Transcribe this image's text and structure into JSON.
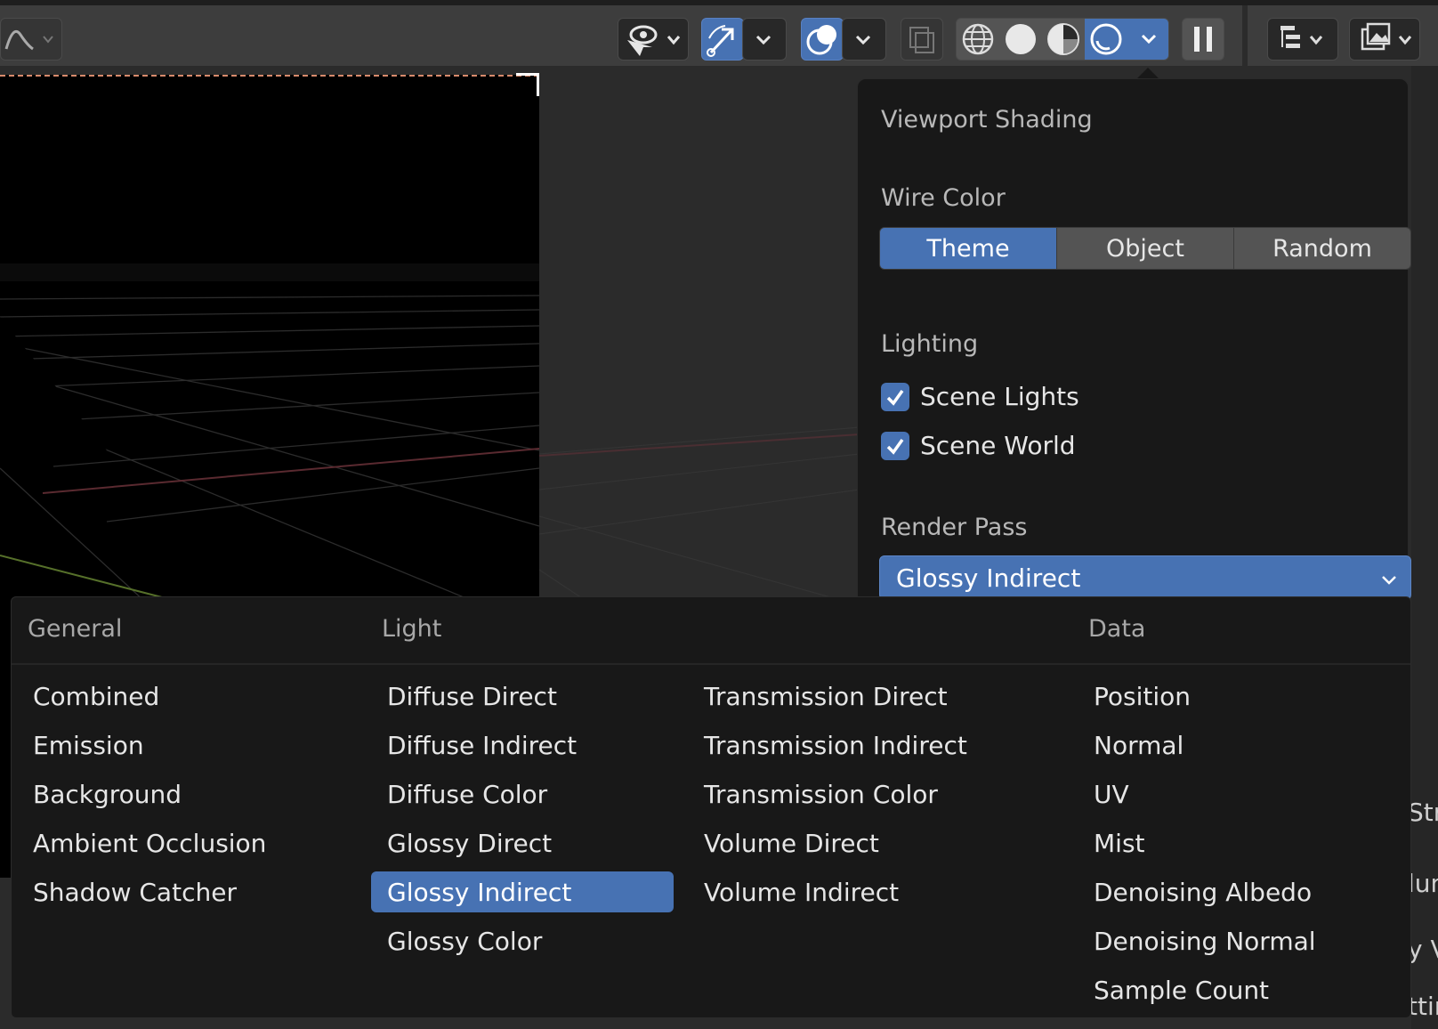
{
  "header": {
    "buttons": [
      {
        "name": "graph-icon"
      },
      {
        "name": "eye-icon"
      },
      {
        "name": "gizmo-icon"
      },
      {
        "name": "overlay-icon"
      },
      {
        "name": "xray-icon"
      },
      {
        "name": "wireframe-shading-icon"
      },
      {
        "name": "solid-shading-icon"
      },
      {
        "name": "material-shading-icon"
      },
      {
        "name": "rendered-shading-icon"
      },
      {
        "name": "pause-icon"
      },
      {
        "name": "outliner-icon"
      },
      {
        "name": "image-icon"
      }
    ]
  },
  "shading": {
    "title": "Viewport Shading",
    "wire_color": {
      "label": "Wire Color",
      "options": [
        "Theme",
        "Object",
        "Random"
      ],
      "selected": "Theme"
    },
    "lighting": {
      "label": "Lighting",
      "scene_lights": "Scene Lights",
      "scene_world": "Scene World",
      "scene_lights_checked": true,
      "scene_world_checked": true
    },
    "render_pass": {
      "label": "Render Pass",
      "value": "Glossy Indirect"
    }
  },
  "menu": {
    "headers": {
      "general": "General",
      "light": "Light",
      "data": "Data"
    },
    "general": [
      "Combined",
      "Emission",
      "Background",
      "Ambient Occlusion",
      "Shadow Catcher"
    ],
    "light_a": [
      "Diffuse Direct",
      "Diffuse Indirect",
      "Diffuse Color",
      "Glossy Direct",
      "Glossy Indirect",
      "Glossy Color"
    ],
    "light_b": [
      "Transmission Direct",
      "Transmission Indirect",
      "Transmission Color",
      "Volume Direct",
      "Volume Indirect"
    ],
    "data": [
      "Position",
      "Normal",
      "UV",
      "Mist",
      "Denoising Albedo",
      "Denoising Normal",
      "Sample Count"
    ],
    "selected": "Glossy Indirect"
  },
  "right_edge_fragments": [
    "Stre",
    "lum",
    "y V",
    "ttir"
  ],
  "colors": {
    "accent": "#4772b3",
    "panel": "#181818",
    "header": "#3d3d3d"
  }
}
